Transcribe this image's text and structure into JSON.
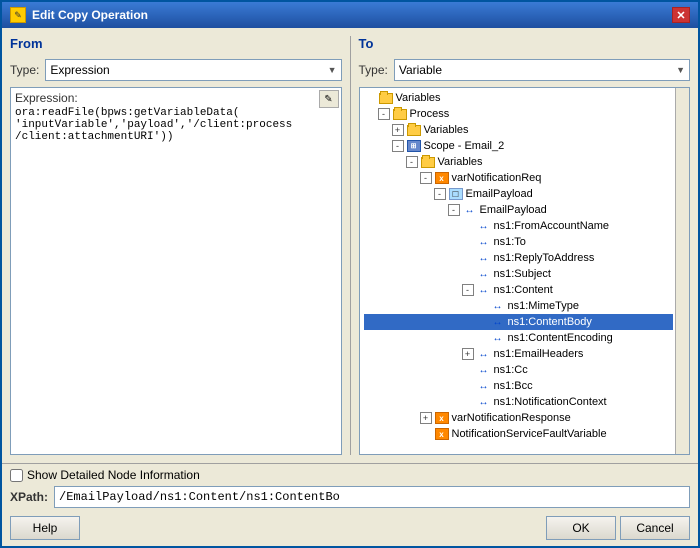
{
  "window": {
    "title": "Edit Copy Operation",
    "icon_label": "✎"
  },
  "from_panel": {
    "title": "From",
    "type_label": "Type:",
    "type_value": "Expression",
    "expression_label": "Expression:",
    "expression_value": "ora:readFile(bpws:getVariableData(\n'inputVariable','payload','/client:process\n/client:attachmentURI'))"
  },
  "to_panel": {
    "title": "To",
    "type_label": "Type:",
    "type_value": "Variable"
  },
  "tree": {
    "items": [
      {
        "id": "variables-root",
        "label": "Variables",
        "indent": 0,
        "type": "folder",
        "toggle": null
      },
      {
        "id": "process",
        "label": "Process",
        "indent": 1,
        "type": "folder",
        "toggle": "-"
      },
      {
        "id": "process-vars",
        "label": "Variables",
        "indent": 2,
        "type": "folder",
        "toggle": "+"
      },
      {
        "id": "scope-email2",
        "label": "Scope - Email_2",
        "indent": 2,
        "type": "scope",
        "toggle": "-"
      },
      {
        "id": "scope-vars",
        "label": "Variables",
        "indent": 3,
        "type": "folder",
        "toggle": "-"
      },
      {
        "id": "varNotificationReq",
        "label": "varNotificationReq",
        "indent": 4,
        "type": "var",
        "toggle": "-"
      },
      {
        "id": "emailPayload",
        "label": "EmailPayload",
        "indent": 5,
        "type": "element",
        "toggle": "-"
      },
      {
        "id": "emailPayload2",
        "label": "EmailPayload",
        "indent": 6,
        "type": "arrow",
        "toggle": "-"
      },
      {
        "id": "fromAccountName",
        "label": "ns1:FromAccountName",
        "indent": 7,
        "type": "arrow",
        "toggle": null
      },
      {
        "id": "to",
        "label": "ns1:To",
        "indent": 7,
        "type": "arrow",
        "toggle": null
      },
      {
        "id": "replyToAddress",
        "label": "ns1:ReplyToAddress",
        "indent": 7,
        "type": "arrow",
        "toggle": null
      },
      {
        "id": "subject",
        "label": "ns1:Subject",
        "indent": 7,
        "type": "arrow",
        "toggle": null
      },
      {
        "id": "content",
        "label": "ns1:Content",
        "indent": 7,
        "type": "arrow",
        "toggle": "-"
      },
      {
        "id": "mimeType",
        "label": "ns1:MimeType",
        "indent": 8,
        "type": "arrow",
        "toggle": null
      },
      {
        "id": "contentBody",
        "label": "ns1:ContentBody",
        "indent": 8,
        "type": "arrow",
        "toggle": null,
        "selected": true
      },
      {
        "id": "contentEncoding",
        "label": "ns1:ContentEncoding",
        "indent": 8,
        "type": "arrow",
        "toggle": null
      },
      {
        "id": "emailHeaders",
        "label": "ns1:EmailHeaders",
        "indent": 7,
        "type": "arrow",
        "toggle": "+"
      },
      {
        "id": "cc",
        "label": "ns1:Cc",
        "indent": 7,
        "type": "arrow",
        "toggle": null
      },
      {
        "id": "bcc",
        "label": "ns1:Bcc",
        "indent": 7,
        "type": "arrow",
        "toggle": null
      },
      {
        "id": "notificationContext",
        "label": "ns1:NotificationContext",
        "indent": 7,
        "type": "arrow",
        "toggle": null
      },
      {
        "id": "varNotificationResponse",
        "label": "varNotificationResponse",
        "indent": 4,
        "type": "var",
        "toggle": "+"
      },
      {
        "id": "notificationFaultVar",
        "label": "NotificationServiceFaultVariable",
        "indent": 4,
        "type": "var",
        "toggle": null
      }
    ]
  },
  "bottom": {
    "checkbox_label": "Show Detailed Node Information",
    "xpath_label": "XPath:",
    "xpath_value": "/EmailPayload/ns1:Content/ns1:ContentBo"
  },
  "buttons": {
    "help": "Help",
    "ok": "OK",
    "cancel": "Cancel"
  }
}
